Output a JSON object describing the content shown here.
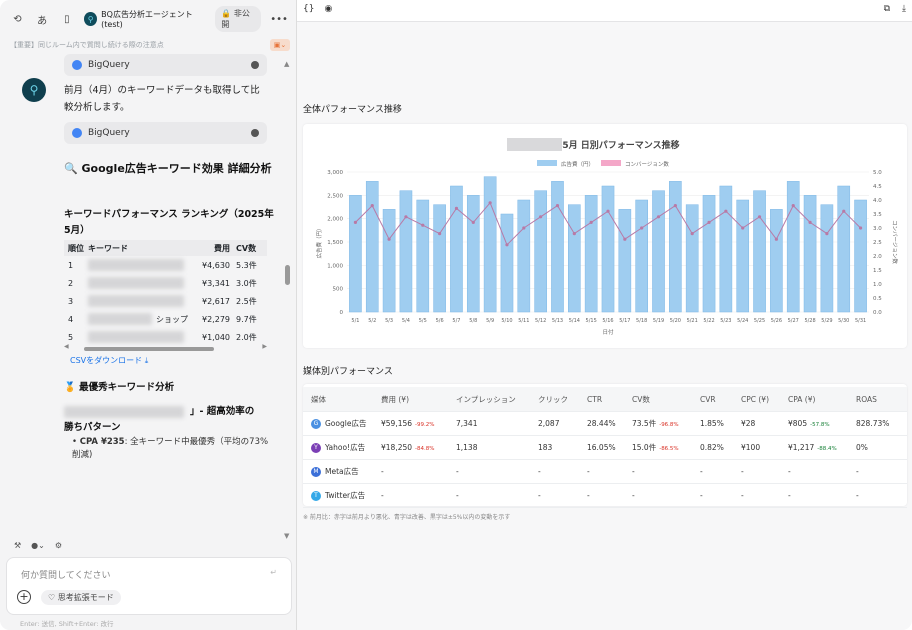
{
  "header": {
    "agent_name": "BQ広告分析エージェント(test)",
    "visibility": "非公開",
    "subtitle": "【重要】同じルーム内で質問し続ける際の注意点"
  },
  "chat": {
    "tool_label": "BigQuery",
    "msg1": "前月（4月）のキーワードデータも取得して比較分析します。",
    "heading": "🔍 Google広告キーワード効果 詳細分析",
    "table_title": "キーワードパフォーマンス ランキング（2025年5月）",
    "table_headers": [
      "順位",
      "キーワード",
      "費用",
      "CV数"
    ],
    "table_rows": [
      {
        "rank": "1",
        "kw": "",
        "cost": "¥4,630",
        "cv": "5.3件"
      },
      {
        "rank": "2",
        "kw": "",
        "cost": "¥3,341",
        "cv": "3.0件"
      },
      {
        "rank": "3",
        "kw": "",
        "cost": "¥2,617",
        "cv": "2.5件"
      },
      {
        "rank": "4",
        "kw": "ショップ",
        "cost": "¥2,279",
        "cv": "9.7件"
      },
      {
        "rank": "5",
        "kw": "",
        "cost": "¥1,040",
        "cv": "2.0件"
      }
    ],
    "csv_link": "CSVをダウンロード",
    "best_heading": "🏅 最優秀キーワード分析",
    "best_sub1": "」- 超高効率の",
    "best_sub2": "勝ちパターン",
    "bullet_bold": "CPA ¥235",
    "bullet_rest": ": 全キーワード中最優秀（平均の73%削減)",
    "input_placeholder": "何か質問してください",
    "mode_label": "思考拡張モード",
    "hint": "Enter: 送信, Shift+Enter: 改行"
  },
  "right": {
    "section1": "全体パフォーマンス推移",
    "section2": "媒体別パフォーマンス",
    "note": "※ 前月比：赤字は前月より悪化、青字は改善、黒字は±5%以内の変動を示す"
  },
  "chart_data": {
    "type": "bar",
    "title": "2025年5月 日別パフォーマンス推移",
    "xlabel": "日付",
    "ylabel": "広告費（円）",
    "y2label": "コンバージョン数",
    "ylim": [
      0,
      3000
    ],
    "y2lim": [
      0,
      5
    ],
    "yticks": [
      "0",
      "500",
      "1,000",
      "1,500",
      "2,000",
      "2,500",
      "3,000"
    ],
    "y2ticks": [
      "0.0",
      "0.5",
      "1.0",
      "1.5",
      "2.0",
      "2.5",
      "3.0",
      "3.5",
      "4.0",
      "4.5",
      "5.0"
    ],
    "categories": [
      "5/1",
      "5/2",
      "5/3",
      "5/4",
      "5/5",
      "5/6",
      "5/7",
      "5/8",
      "5/9",
      "5/10",
      "5/11",
      "5/12",
      "5/13",
      "5/14",
      "5/15",
      "5/16",
      "5/17",
      "5/18",
      "5/19",
      "5/20",
      "5/21",
      "5/22",
      "5/23",
      "5/24",
      "5/25",
      "5/26",
      "5/27",
      "5/28",
      "5/29",
      "5/30",
      "5/31"
    ],
    "series": [
      {
        "name": "広告費（円）",
        "type": "bar",
        "color": "#9fcdf0",
        "values": [
          2500,
          2800,
          2200,
          2600,
          2400,
          2300,
          2700,
          2500,
          2900,
          2100,
          2400,
          2600,
          2800,
          2300,
          2500,
          2700,
          2200,
          2400,
          2600,
          2800,
          2300,
          2500,
          2700,
          2400,
          2600,
          2200,
          2800,
          2500,
          2300,
          2700,
          2400
        ]
      },
      {
        "name": "コンバージョン数",
        "type": "line",
        "color": "#b87aa6",
        "values": [
          3.2,
          3.8,
          2.6,
          3.4,
          3.1,
          2.8,
          3.7,
          3.2,
          3.9,
          2.4,
          3.0,
          3.4,
          3.8,
          2.8,
          3.2,
          3.6,
          2.6,
          3.0,
          3.4,
          3.8,
          2.8,
          3.2,
          3.6,
          3.0,
          3.4,
          2.6,
          3.8,
          3.2,
          2.8,
          3.6,
          3.0
        ]
      }
    ]
  },
  "media_table": {
    "headers": [
      "媒体",
      "費用 (¥)",
      "インプレッション",
      "クリック",
      "CTR",
      "CV数",
      "CVR",
      "CPC (¥)",
      "CPA (¥)",
      "ROAS"
    ],
    "rows": [
      {
        "name": "Google広告",
        "icon": "G",
        "color": "#4a90e2",
        "cost": "¥59,156",
        "cost_d": "-99.2%",
        "imp": "7,341",
        "clk": "2,087",
        "ctr": "28.44%",
        "cv": "73.5件",
        "cv_d": "-96.8%",
        "cvr": "1.85%",
        "cpc": "¥28",
        "cpa": "¥805",
        "cpa_d": "-57.8%",
        "roas": "828.73%"
      },
      {
        "name": "Yahoo!広告",
        "icon": "Y",
        "color": "#7b3fb5",
        "cost": "¥18,250",
        "cost_d": "-84.8%",
        "imp": "1,138",
        "clk": "183",
        "ctr": "16.05%",
        "cv": "15.0件",
        "cv_d": "-86.5%",
        "cvr": "0.82%",
        "cpc": "¥100",
        "cpa": "¥1,217",
        "cpa_d": "-88.4%",
        "roas": "0%"
      },
      {
        "name": "Meta広告",
        "icon": "M",
        "color": "#3b6fd8",
        "cost": "-",
        "cost_d": "",
        "imp": "-",
        "clk": "-",
        "ctr": "-",
        "cv": "-",
        "cv_d": "",
        "cvr": "-",
        "cpc": "-",
        "cpa": "-",
        "cpa_d": "",
        "roas": "-"
      },
      {
        "name": "Twitter広告",
        "icon": "T",
        "color": "#33a8e8",
        "cost": "-",
        "cost_d": "",
        "imp": "-",
        "clk": "-",
        "ctr": "-",
        "cv": "-",
        "cv_d": "",
        "cvr": "-",
        "cpc": "-",
        "cpa": "-",
        "cpa_d": "",
        "roas": "-"
      }
    ]
  }
}
